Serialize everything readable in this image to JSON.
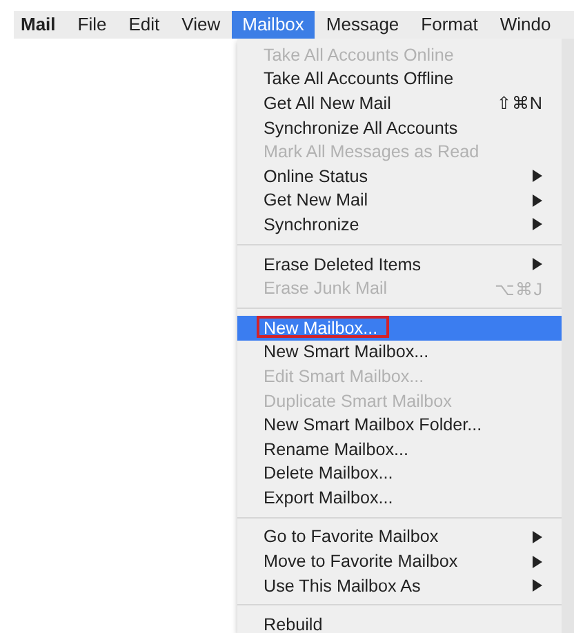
{
  "menubar": [
    {
      "label": "Mail",
      "kind": "app",
      "selected": false
    },
    {
      "label": "File",
      "kind": "menu",
      "selected": false
    },
    {
      "label": "Edit",
      "kind": "menu",
      "selected": false
    },
    {
      "label": "View",
      "kind": "menu",
      "selected": false
    },
    {
      "label": "Mailbox",
      "kind": "menu",
      "selected": true
    },
    {
      "label": "Message",
      "kind": "menu",
      "selected": false
    },
    {
      "label": "Format",
      "kind": "menu",
      "selected": false
    },
    {
      "label": "Windo",
      "kind": "menu",
      "selected": false
    }
  ],
  "menu": {
    "sections": [
      [
        {
          "label": "Take All Accounts Online",
          "disabled": true,
          "selected": false,
          "submenu": false
        },
        {
          "label": "Take All Accounts Offline",
          "disabled": false,
          "selected": false,
          "submenu": false
        },
        {
          "label": "Get All New Mail",
          "disabled": false,
          "selected": false,
          "submenu": false,
          "shortcut": "⇧⌘N"
        },
        {
          "label": "Synchronize All Accounts",
          "disabled": false,
          "selected": false,
          "submenu": false
        },
        {
          "label": "Mark All Messages as Read",
          "disabled": true,
          "selected": false,
          "submenu": false
        },
        {
          "label": "Online Status",
          "disabled": false,
          "selected": false,
          "submenu": true
        },
        {
          "label": "Get New Mail",
          "disabled": false,
          "selected": false,
          "submenu": true
        },
        {
          "label": "Synchronize",
          "disabled": false,
          "selected": false,
          "submenu": true
        }
      ],
      [
        {
          "label": "Erase Deleted Items",
          "disabled": false,
          "selected": false,
          "submenu": true
        },
        {
          "label": "Erase Junk Mail",
          "disabled": true,
          "selected": false,
          "submenu": false,
          "shortcut": "⌥⌘J"
        }
      ],
      [
        {
          "label": "New Mailbox...",
          "disabled": false,
          "selected": true,
          "submenu": false,
          "annotated": true
        },
        {
          "label": "New Smart Mailbox...",
          "disabled": false,
          "selected": false,
          "submenu": false
        },
        {
          "label": "Edit Smart Mailbox...",
          "disabled": true,
          "selected": false,
          "submenu": false
        },
        {
          "label": "Duplicate Smart Mailbox",
          "disabled": true,
          "selected": false,
          "submenu": false
        },
        {
          "label": "New Smart Mailbox Folder...",
          "disabled": false,
          "selected": false,
          "submenu": false
        },
        {
          "label": "Rename Mailbox...",
          "disabled": false,
          "selected": false,
          "submenu": false
        },
        {
          "label": "Delete Mailbox...",
          "disabled": false,
          "selected": false,
          "submenu": false
        },
        {
          "label": "Export Mailbox...",
          "disabled": false,
          "selected": false,
          "submenu": false
        }
      ],
      [
        {
          "label": "Go to Favorite Mailbox",
          "disabled": false,
          "selected": false,
          "submenu": true
        },
        {
          "label": "Move to Favorite Mailbox",
          "disabled": false,
          "selected": false,
          "submenu": true
        },
        {
          "label": "Use This Mailbox As",
          "disabled": false,
          "selected": false,
          "submenu": true
        }
      ],
      [
        {
          "label": "Rebuild",
          "disabled": false,
          "selected": false,
          "submenu": false
        }
      ]
    ]
  }
}
